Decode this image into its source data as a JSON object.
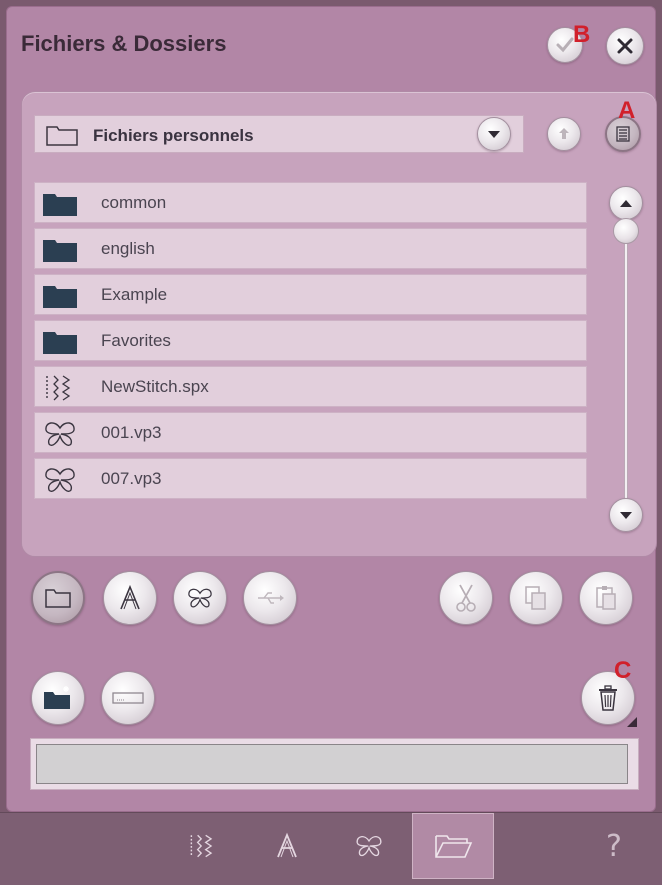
{
  "window": {
    "title": "Fichiers & Dossiers",
    "markers": {
      "a": "A",
      "b": "B",
      "c": "C"
    },
    "confirm_icon": "check-icon",
    "close_icon": "close-icon"
  },
  "folder_selector": {
    "label": "Fichiers personnels",
    "icon": "folder-outline-icon",
    "dropdown_icon": "chevron-down-icon"
  },
  "file_list": {
    "items": [
      {
        "name": "common",
        "type": "folder",
        "icon": "folder-icon"
      },
      {
        "name": "english",
        "type": "folder",
        "icon": "folder-icon"
      },
      {
        "name": "Example",
        "type": "folder",
        "icon": "folder-icon"
      },
      {
        "name": "Favorites",
        "type": "folder",
        "icon": "folder-icon"
      },
      {
        "name": "NewStitch.spx",
        "type": "stitch",
        "icon": "stitch-icon"
      },
      {
        "name": "001.vp3",
        "type": "embroidery",
        "icon": "butterfly-icon"
      },
      {
        "name": "007.vp3",
        "type": "embroidery",
        "icon": "butterfly-icon"
      }
    ]
  },
  "filter_buttons": [
    {
      "name": "all-files",
      "icon": "folder-outline-icon",
      "active": true
    },
    {
      "name": "fonts",
      "icon": "font-a-icon",
      "active": false
    },
    {
      "name": "embroideries",
      "icon": "butterfly-icon",
      "active": false
    },
    {
      "name": "usb",
      "icon": "usb-icon",
      "active": false
    }
  ],
  "edit_buttons": [
    {
      "name": "cut",
      "icon": "scissors-icon",
      "enabled": false
    },
    {
      "name": "copy",
      "icon": "copy-icon",
      "enabled": false
    },
    {
      "name": "paste",
      "icon": "paste-icon",
      "enabled": false
    }
  ],
  "message_field": {
    "value": ""
  },
  "taskbar": {
    "tabs": [
      {
        "name": "stitch-menu",
        "icon": "stitch-icon",
        "active": false
      },
      {
        "name": "fonts",
        "icon": "font-a-icon",
        "active": false
      },
      {
        "name": "embroidery",
        "icon": "butterfly-icon",
        "active": false
      },
      {
        "name": "file-manager",
        "icon": "open-folder-icon",
        "active": true
      }
    ],
    "help": "?"
  },
  "colors": {
    "window_bg": "#b286a6",
    "panel_bg": "#c7a3bd",
    "row_bg": "#e2cfdc",
    "marker_red": "#d1202b",
    "taskbar_bg": "#7d5f73"
  }
}
